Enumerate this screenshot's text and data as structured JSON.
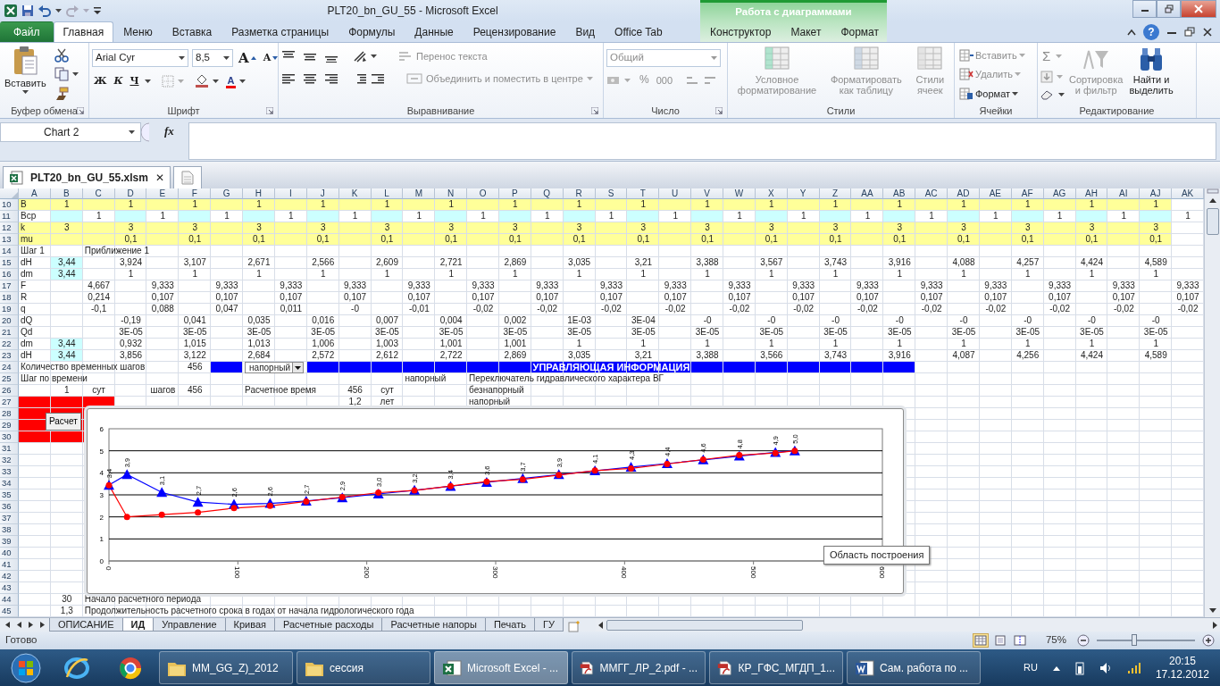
{
  "window": {
    "title": "PLT20_bn_GU_55  -  Microsoft Excel",
    "context_group": "Работа с диаграммами",
    "help": "?"
  },
  "tabs": [
    {
      "label": "Файл",
      "kind": "file",
      "selected": false
    },
    {
      "label": "Главная",
      "kind": "main",
      "selected": true
    },
    {
      "label": "Меню",
      "kind": "main",
      "selected": false
    },
    {
      "label": "Вставка",
      "kind": "main",
      "selected": false
    },
    {
      "label": "Разметка страницы",
      "kind": "main",
      "selected": false
    },
    {
      "label": "Формулы",
      "kind": "main",
      "selected": false
    },
    {
      "label": "Данные",
      "kind": "main",
      "selected": false
    },
    {
      "label": "Рецензирование",
      "kind": "main",
      "selected": false
    },
    {
      "label": "Вид",
      "kind": "main",
      "selected": false
    },
    {
      "label": "Office Tab",
      "kind": "main",
      "selected": false
    },
    {
      "label": "Конструктор",
      "kind": "context",
      "selected": false
    },
    {
      "label": "Макет",
      "kind": "context",
      "selected": false
    },
    {
      "label": "Формат",
      "kind": "context",
      "selected": false
    }
  ],
  "ribbon": {
    "clipboard": {
      "label": "Буфер обмена",
      "paste": "Вставить"
    },
    "font": {
      "label": "Шрифт",
      "name": "Arial Cyr",
      "size": "8,5",
      "grow": "A",
      "shrink": "A",
      "bold": "Ж",
      "italic": "К",
      "underline": "Ч",
      "font_color_label": "A"
    },
    "alignment": {
      "label": "Выравнивание",
      "wrap": {
        "label": "Перенос текста",
        "disabled": true
      },
      "merge": {
        "label": "Объединить и поместить в центре",
        "disabled": true
      }
    },
    "number": {
      "label": "Число",
      "format": {
        "value": "Общий",
        "disabled": true
      },
      "percent": "%",
      "thousands": "000"
    },
    "styles": {
      "label": "Стили",
      "buttons": [
        {
          "lines": [
            "Условное",
            "форматирование"
          ],
          "disabled": true
        },
        {
          "lines": [
            "Форматировать",
            "как таблицу"
          ],
          "disabled": true
        },
        {
          "lines": [
            "Стили",
            "ячеек"
          ],
          "disabled": true
        }
      ]
    },
    "cells": {
      "label": "Ячейки",
      "buttons": [
        {
          "label": "Вставить",
          "disabled": true
        },
        {
          "label": "Удалить",
          "disabled": true
        },
        {
          "label": "Формат",
          "disabled": false
        }
      ]
    },
    "editing": {
      "label": "Редактирование",
      "sum": {
        "label": "Σ",
        "disabled": true
      },
      "buttons": [
        {
          "lines": [
            "Сортировка",
            "и фильтр"
          ],
          "disabled": true
        },
        {
          "lines": [
            "Найти и",
            "выделить"
          ],
          "disabled": false
        }
      ]
    }
  },
  "formula_bar": {
    "name_box": "Chart 2",
    "function_label": "fx"
  },
  "document_tab": {
    "label": "PLT20_bn_GU_55.xlsm",
    "close": "✕"
  },
  "sheet": {
    "columns": [
      "A",
      "B",
      "C",
      "D",
      "E",
      "F",
      "G",
      "H",
      "I",
      "J",
      "K",
      "L",
      "M",
      "N",
      "O",
      "P",
      "Q",
      "R",
      "S",
      "T",
      "U",
      "V",
      "W",
      "X",
      "Y",
      "Z",
      "AA",
      "AB",
      "AC",
      "AD",
      "AE",
      "AF",
      "AG",
      "AH",
      "AI",
      "AJ",
      "AK"
    ],
    "rows": [
      {
        "num": "10",
        "color": "#ffff99",
        "cells": [
          "B",
          "1",
          null,
          "1",
          null,
          "1",
          null,
          "1",
          null,
          "1",
          null,
          "1",
          null,
          "1",
          null,
          "1",
          null,
          "1",
          null,
          "1",
          null,
          "1",
          null,
          "1",
          null,
          "1",
          null,
          "1",
          null,
          "1",
          null,
          "1",
          null,
          "1",
          null,
          "1"
        ]
      },
      {
        "num": "11",
        "cells": [
          "Вср",
          {
            "color": "#ccffff"
          },
          "1",
          {
            "color": "#ccffff"
          },
          "1",
          {
            "color": "#ccffff"
          },
          "1",
          {
            "color": "#ccffff"
          },
          "1",
          {
            "color": "#ccffff"
          },
          "1",
          {
            "color": "#ccffff"
          },
          "1",
          {
            "color": "#ccffff"
          },
          "1",
          {
            "color": "#ccffff"
          },
          "1",
          {
            "color": "#ccffff"
          },
          "1",
          {
            "color": "#ccffff"
          },
          "1",
          {
            "color": "#ccffff"
          },
          "1",
          {
            "color": "#ccffff"
          },
          "1",
          {
            "color": "#ccffff"
          },
          "1",
          {
            "color": "#ccffff"
          },
          "1",
          {
            "color": "#ccffff"
          },
          "1",
          {
            "color": "#ccffff"
          },
          "1",
          {
            "color": "#ccffff"
          },
          "1",
          {
            "color": "#ccffff"
          },
          "1"
        ]
      },
      {
        "num": "12",
        "color": "#ffff99",
        "cells": [
          "k",
          "3",
          null,
          "3",
          null,
          "3",
          null,
          "3",
          null,
          "3",
          null,
          "3",
          null,
          "3",
          null,
          "3",
          null,
          "3",
          null,
          "3",
          null,
          "3",
          null,
          "3",
          null,
          "3",
          null,
          "3",
          null,
          "3",
          null,
          "3",
          null,
          "3",
          null,
          "3"
        ]
      },
      {
        "num": "13",
        "color": "#ffff99",
        "cells": [
          "mu",
          null,
          null,
          "0,1",
          null,
          "0,1",
          null,
          "0,1",
          null,
          "0,1",
          null,
          "0,1",
          null,
          "0,1",
          null,
          "0,1",
          null,
          "0,1",
          null,
          "0,1",
          null,
          "0,1",
          null,
          "0,1",
          null,
          "0,1",
          null,
          "0,1",
          null,
          "0,1",
          null,
          "0,1",
          null,
          "0,1",
          null,
          "0,1"
        ]
      },
      {
        "num": "14",
        "cells": [
          "Шаг 1",
          null,
          "Приближение 1"
        ]
      },
      {
        "num": "15",
        "cells": [
          "dH",
          {
            "text": "3,44",
            "color": "#ccffff"
          },
          null,
          "3,924",
          null,
          "3,107",
          null,
          "2,671",
          null,
          "2,566",
          null,
          "2,609",
          null,
          "2,721",
          null,
          "2,869",
          null,
          "3,035",
          null,
          "3,21",
          null,
          "3,388",
          null,
          "3,567",
          null,
          "3,743",
          null,
          "3,916",
          null,
          "4,088",
          null,
          "4,257",
          null,
          "4,424",
          null,
          "4,589"
        ]
      },
      {
        "num": "16",
        "cells": [
          "dm",
          {
            "text": "3,44",
            "color": "#ccffff"
          },
          null,
          "1",
          null,
          "1",
          null,
          "1",
          null,
          "1",
          null,
          "1",
          null,
          "1",
          null,
          "1",
          null,
          "1",
          null,
          "1",
          null,
          "1",
          null,
          "1",
          null,
          "1",
          null,
          "1",
          null,
          "1",
          null,
          "1",
          null,
          "1",
          null,
          "1"
        ]
      },
      {
        "num": "17",
        "cells": [
          "F",
          null,
          "4,667",
          null,
          "9,333",
          null,
          "9,333",
          null,
          "9,333",
          null,
          "9,333",
          null,
          "9,333",
          null,
          "9,333",
          null,
          "9,333",
          null,
          "9,333",
          null,
          "9,333",
          null,
          "9,333",
          null,
          "9,333",
          null,
          "9,333",
          null,
          "9,333",
          null,
          "9,333",
          null,
          "9,333",
          null,
          "9,333",
          null,
          "9,333"
        ]
      },
      {
        "num": "18",
        "cells": [
          "R",
          null,
          "0,214",
          null,
          "0,107",
          null,
          "0,107",
          null,
          "0,107",
          null,
          "0,107",
          null,
          "0,107",
          null,
          "0,107",
          null,
          "0,107",
          null,
          "0,107",
          null,
          "0,107",
          null,
          "0,107",
          null,
          "0,107",
          null,
          "0,107",
          null,
          "0,107",
          null,
          "0,107",
          null,
          "0,107",
          null,
          "0,107",
          null,
          "0,107"
        ]
      },
      {
        "num": "19",
        "cells": [
          "q",
          null,
          "-0,1",
          null,
          "0,088",
          null,
          "0,047",
          null,
          "0,011",
          null,
          "-0",
          null,
          "-0,01",
          null,
          "-0,02",
          null,
          "-0,02",
          null,
          "-0,02",
          null,
          "-0,02",
          null,
          "-0,02",
          null,
          "-0,02",
          null,
          "-0,02",
          null,
          "-0,02",
          null,
          "-0,02",
          null,
          "-0,02",
          null,
          "-0,02",
          null,
          "-0,02"
        ]
      },
      {
        "num": "20",
        "cells": [
          "dQ",
          null,
          null,
          "-0,19",
          null,
          "0,041",
          null,
          "0,035",
          null,
          "0,016",
          null,
          "0,007",
          null,
          "0,004",
          null,
          "0,002",
          null,
          "1E-03",
          null,
          "3E-04",
          null,
          "-0",
          null,
          "-0",
          null,
          "-0",
          null,
          "-0",
          null,
          "-0",
          null,
          "-0",
          null,
          "-0",
          null,
          "-0"
        ]
      },
      {
        "num": "21",
        "cells": [
          "Qd",
          null,
          null,
          "3E-05",
          null,
          "3E-05",
          null,
          "3E-05",
          null,
          "3E-05",
          null,
          "3E-05",
          null,
          "3E-05",
          null,
          "3E-05",
          null,
          "3E-05",
          null,
          "3E-05",
          null,
          "3E-05",
          null,
          "3E-05",
          null,
          "3E-05",
          null,
          "3E-05",
          null,
          "3E-05",
          null,
          "3E-05",
          null,
          "3E-05",
          null,
          "3E-05"
        ]
      },
      {
        "num": "22",
        "cells": [
          "dm",
          {
            "text": "3,44",
            "color": "#ccffff"
          },
          null,
          "0,932",
          null,
          "1,015",
          null,
          "1,013",
          null,
          "1,006",
          null,
          "1,003",
          null,
          "1,001",
          null,
          "1,001",
          null,
          "1",
          null,
          "1",
          null,
          "1",
          null,
          "1",
          null,
          "1",
          null,
          "1",
          null,
          "1",
          null,
          "1",
          null,
          "1",
          null,
          "1"
        ]
      },
      {
        "num": "23",
        "cells": [
          "dH",
          {
            "text": "3,44",
            "color": "#ccffff"
          },
          null,
          "3,856",
          null,
          "3,122",
          null,
          "2,684",
          null,
          "2,572",
          null,
          "2,612",
          null,
          "2,722",
          null,
          "2,869",
          null,
          "3,035",
          null,
          "3,21",
          null,
          "3,388",
          null,
          "3,566",
          null,
          "3,743",
          null,
          "3,916",
          null,
          "4,087",
          null,
          "4,256",
          null,
          "4,424",
          null,
          "4,589"
        ]
      },
      {
        "num": "24",
        "cells": [
          "Количество временных шагов",
          null,
          null,
          null,
          null,
          "456",
          {
            "color": "#0000ff"
          },
          {
            "text": "напорный",
            "kind": "dropdown"
          },
          null,
          {
            "text": "УПРАВЛЯЮЩАЯ ИНФОРМАЦИЯ",
            "kind": "header",
            "color": "#0000ff"
          },
          {
            "color": "#0000ff"
          },
          {
            "color": "#0000ff"
          },
          {
            "color": "#0000ff"
          },
          {
            "color": "#0000ff"
          },
          {
            "color": "#0000ff"
          },
          {
            "color": "#0000ff"
          },
          {
            "color": "#0000ff"
          },
          {
            "color": "#0000ff"
          },
          {
            "color": "#0000ff"
          },
          {
            "color": "#0000ff"
          },
          {
            "color": "#0000ff"
          },
          {
            "color": "#0000ff"
          },
          {
            "color": "#0000ff"
          },
          {
            "color": "#0000ff"
          },
          {
            "color": "#0000ff"
          },
          {
            "color": "#0000ff"
          },
          {
            "color": "#0000ff"
          },
          {
            "color": "#0000ff"
          }
        ]
      },
      {
        "num": "25",
        "cells": [
          "Шаг по времени",
          null,
          null,
          null,
          null,
          null,
          null,
          null,
          null,
          null,
          null,
          null,
          "напорный",
          null,
          "Переключатель гидравлического характера ВГ"
        ]
      },
      {
        "num": "26",
        "cells": [
          null,
          "1",
          "сут",
          null,
          "шагов",
          "456",
          null,
          "Расчетное время",
          null,
          null,
          "456",
          "сут",
          null,
          null,
          "безнапорный"
        ]
      },
      {
        "num": "27",
        "cells": [
          {
            "color": "#ff0000"
          },
          {
            "color": "#ff0000"
          },
          {
            "color": "#ff0000"
          },
          null,
          null,
          null,
          null,
          null,
          null,
          null,
          "1,2",
          "лет",
          null,
          null,
          "напорный"
        ]
      },
      {
        "num": "28",
        "cells": [
          {
            "color": "#ff0000"
          },
          {
            "text": "Расчет",
            "kind": "button",
            "color": "#ff0000"
          },
          {
            "color": "#ff0000"
          }
        ]
      },
      {
        "num": "29",
        "cells": [
          {
            "color": "#ff0000"
          },
          {
            "color": "#ff0000"
          },
          {
            "color": "#ff0000"
          }
        ]
      },
      {
        "num": "30",
        "cells": [
          {
            "color": "#ff0000"
          },
          {
            "color": "#ff0000"
          },
          {
            "color": "#ff0000"
          }
        ]
      },
      {
        "num": "31"
      },
      {
        "num": "32"
      },
      {
        "num": "33"
      },
      {
        "num": "34"
      },
      {
        "num": "35"
      },
      {
        "num": "36"
      },
      {
        "num": "37"
      },
      {
        "num": "38"
      },
      {
        "num": "39"
      },
      {
        "num": "40"
      },
      {
        "num": "41"
      },
      {
        "num": "42"
      },
      {
        "num": "43"
      },
      {
        "num": "44",
        "cells": [
          null,
          "30",
          "Начало расчетного периода"
        ]
      },
      {
        "num": "45",
        "cells": [
          null,
          "1,3",
          "Продолжительность расчетного срока в годах от начала гидрологического года"
        ]
      }
    ]
  },
  "chart": {
    "tooltip": "Область построения",
    "chart_data": {
      "type": "line",
      "x": [
        0,
        14,
        41,
        69,
        97,
        125,
        153,
        181,
        209,
        237,
        265,
        293,
        321,
        349,
        377,
        405,
        433,
        461,
        489,
        517,
        532
      ],
      "xlim": [
        0,
        600
      ],
      "ylim": [
        0,
        6
      ],
      "xticks": [
        0,
        100,
        200,
        300,
        400,
        500,
        600
      ],
      "yticks": [
        0,
        1,
        2,
        3,
        4,
        5,
        6
      ],
      "grid": true,
      "series": [
        {
          "color": "#ff0000",
          "marker": "circle",
          "values": [
            3.44,
            2.0,
            2.1,
            2.2,
            2.4,
            2.5,
            2.7,
            2.9,
            3.1,
            3.2,
            3.4,
            3.6,
            3.7,
            3.9,
            4.1,
            4.2,
            4.4,
            4.6,
            4.8,
            4.9,
            5.0
          ]
        },
        {
          "color": "#0000ff",
          "marker": "triangle",
          "values": [
            3.44,
            3.92,
            3.11,
            2.67,
            2.57,
            2.61,
            2.72,
            2.87,
            3.04,
            3.21,
            3.39,
            3.57,
            3.74,
            3.92,
            4.09,
            4.26,
            4.42,
            4.59,
            4.76,
            4.93,
            5.0
          ],
          "value_labels": [
            "3,4",
            "3,9",
            "3,1",
            "2,7",
            "2,6",
            "2,6",
            "2,7",
            "2,9",
            "3,0",
            "3,2",
            "3,4",
            "3,6",
            "3,7",
            "3,9",
            "4,1",
            "4,3",
            "4,4",
            "4,6",
            "4,8",
            "4,9",
            "5,0"
          ]
        }
      ]
    }
  },
  "sheet_tabs": [
    {
      "label": "ОПИСАНИЕ",
      "selected": false
    },
    {
      "label": "ИД",
      "selected": true
    },
    {
      "label": "Управление",
      "selected": false
    },
    {
      "label": "Кривая",
      "selected": false
    },
    {
      "label": "Расчетные расходы",
      "selected": false
    },
    {
      "label": "Расчетные напоры",
      "selected": false
    },
    {
      "label": "Печать",
      "selected": false
    },
    {
      "label": "ГУ",
      "selected": false
    }
  ],
  "status_bar": {
    "text": "Готово",
    "views": [
      {
        "kind": "normal",
        "selected": true
      },
      {
        "kind": "layout",
        "selected": false
      },
      {
        "kind": "break",
        "selected": false
      }
    ],
    "zoom_text": "75%",
    "zoom": {
      "level": 0.38
    }
  },
  "taskbar": {
    "items": [
      {
        "label": "MM_GG_Z)_2012",
        "kind": "folder",
        "selected": false
      },
      {
        "label": "сессия",
        "kind": "folder",
        "selected": false
      },
      {
        "label": "Microsoft Excel - ...",
        "kind": "excel",
        "selected": true
      },
      {
        "label": "ММГГ_ЛР_2.pdf - ...",
        "kind": "pdf",
        "selected": false
      },
      {
        "label": "КР_ГФС_МГДП_1...",
        "kind": "pdf",
        "selected": false
      },
      {
        "label": "Сам. работа по ...",
        "kind": "word",
        "selected": false
      }
    ],
    "language": "RU",
    "time": "20:15",
    "date": "17.12.2012"
  }
}
